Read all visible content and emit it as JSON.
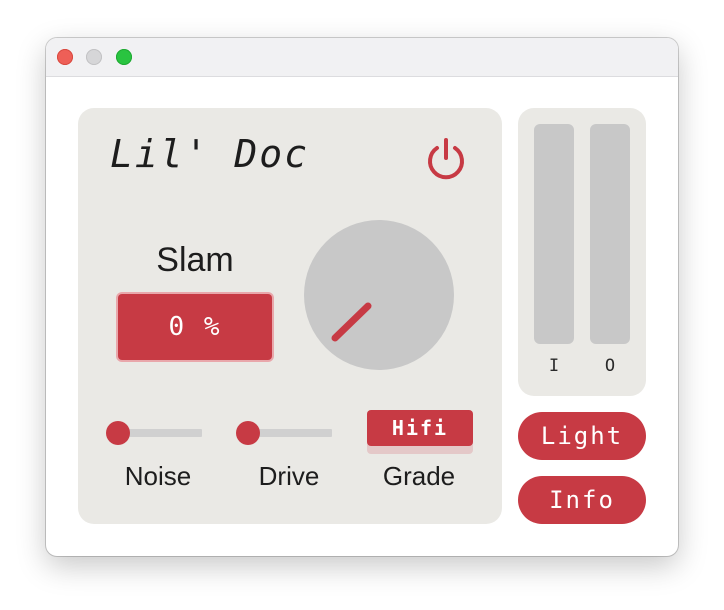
{
  "window": {
    "controls": [
      "close",
      "minimize",
      "zoom"
    ]
  },
  "plugin": {
    "title": "Lil' Doc",
    "power_icon": "power-icon"
  },
  "slam": {
    "label": "Slam",
    "value": "0 %",
    "knob_level": 0
  },
  "controls": {
    "noise": {
      "label": "Noise",
      "level": 0
    },
    "drive": {
      "label": "Drive",
      "level": 0
    },
    "grade": {
      "label": "Grade",
      "value": "Hifi"
    }
  },
  "meters": {
    "input": {
      "label": "I",
      "level": 0
    },
    "output": {
      "label": "O",
      "level": 0
    }
  },
  "buttons": {
    "light": "Light",
    "info": "Info"
  },
  "colors": {
    "accent": "#c73a44",
    "panel": "#eae9e5",
    "inactive": "#c8c8c8"
  }
}
